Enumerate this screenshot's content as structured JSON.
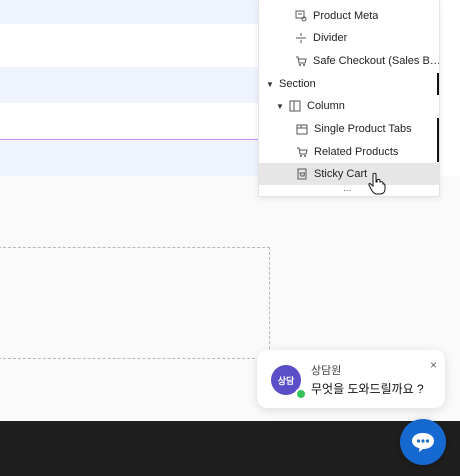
{
  "navigator": {
    "items": [
      {
        "label": "Product Meta",
        "icon": "product-meta-icon"
      },
      {
        "label": "Divider",
        "icon": "divider-icon"
      },
      {
        "label": "Safe Checkout (Sales Boos...",
        "icon": "cart-icon"
      },
      {
        "label": "Section",
        "icon": "caret-icon"
      },
      {
        "label": "Column",
        "icon": "column-icon"
      },
      {
        "label": "Single Product Tabs",
        "icon": "tabs-icon"
      },
      {
        "label": "Related Products",
        "icon": "cart-icon"
      },
      {
        "label": "Sticky Cart",
        "icon": "sticky-cart-icon"
      }
    ],
    "selected": "Sticky Cart",
    "more": "..."
  },
  "chat": {
    "agent_name": "상담원",
    "avatar_text": "상담",
    "message": "무엇을 도와드릴까요 ?",
    "close": "×"
  },
  "colors": {
    "accent": "#1769d2",
    "highlight": "#d58ff0",
    "avatar": "#5b4ec7",
    "online": "#34c05a"
  }
}
